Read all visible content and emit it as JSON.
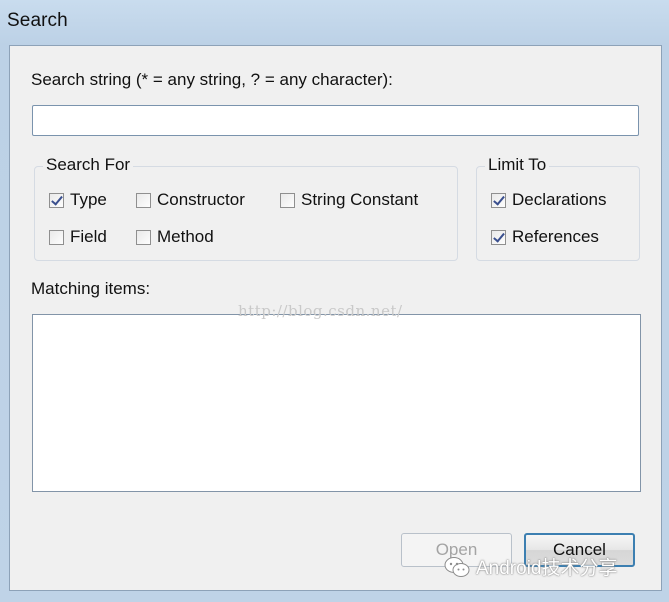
{
  "window": {
    "title": "Search"
  },
  "search": {
    "label": "Search string (* = any string, ? = any character):",
    "value": "",
    "placeholder": ""
  },
  "search_for": {
    "legend": "Search For",
    "options": [
      {
        "label": "Type",
        "checked": true
      },
      {
        "label": "Constructor",
        "checked": false
      },
      {
        "label": "String Constant",
        "checked": false
      },
      {
        "label": "Field",
        "checked": false
      },
      {
        "label": "Method",
        "checked": false
      }
    ]
  },
  "limit_to": {
    "legend": "Limit To",
    "options": [
      {
        "label": "Declarations",
        "checked": true
      },
      {
        "label": "References",
        "checked": true
      }
    ]
  },
  "matching": {
    "label": "Matching items:",
    "items": []
  },
  "watermark": "http://blog.csdn.net/",
  "buttons": {
    "open": "Open",
    "cancel": "Cancel"
  },
  "brand": {
    "text": "Android技术分享",
    "icon": "wechat-icon"
  }
}
